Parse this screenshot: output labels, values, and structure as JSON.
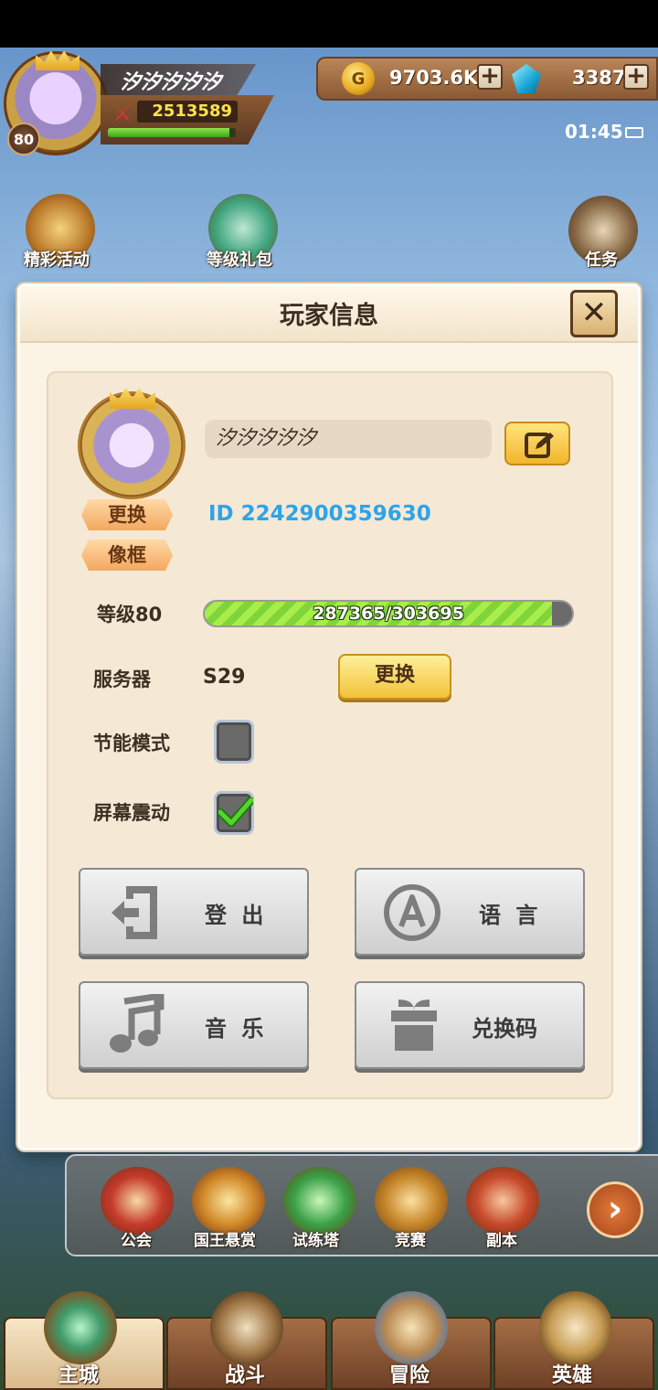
{
  "hud": {
    "player_name": "汐汐汐汐汐",
    "power": "2513589",
    "level_badge": "80",
    "gold": "9703.6K",
    "gems": "3387",
    "time": "01:45",
    "exp_fraction": 0.95
  },
  "side_buttons": {
    "events": "精彩活动",
    "level_gift": "等级礼包",
    "tasks": "任务"
  },
  "dialog": {
    "title": "玩家信息",
    "name_value": "汐汐汐汐汐",
    "change_avatar": "更换",
    "frame": "像框",
    "id_text": "ID 2242900359630",
    "level_label": "等级80",
    "exp_text": "287365/303695",
    "exp_current": 287365,
    "exp_max": 303695,
    "server_label": "服务器",
    "server_value": "S29",
    "server_change": "更换",
    "power_saving_label": "节能模式",
    "power_saving_checked": false,
    "shake_label": "屏幕震动",
    "shake_checked": true,
    "buttons": {
      "logout": "登 出",
      "language": "语 言",
      "music": "音 乐",
      "redeem": "兑换码"
    }
  },
  "quick_bar": [
    "公会",
    "国王悬赏",
    "试练塔",
    "竞赛",
    "副本"
  ],
  "nav": [
    "主城",
    "战斗",
    "冒险",
    "英雄"
  ],
  "colors": {
    "id_blue": "#2fa3e8",
    "exp_green": "#8fe44a",
    "button_yellow": "#f2c23a"
  }
}
